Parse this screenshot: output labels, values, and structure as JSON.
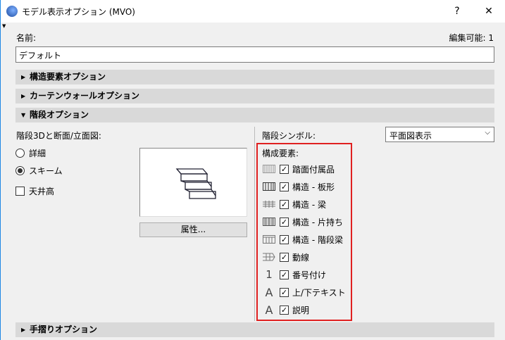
{
  "window": {
    "title": "モデル表示オプション (MVO)",
    "help": "?",
    "close": "✕"
  },
  "name_label": "名前:",
  "editable": "編集可能: 1",
  "name_value": "デフォルト",
  "sections": {
    "structure": "構造要素オプション",
    "curtain": "カーテンウォールオプション",
    "stair": "階段オプション",
    "railing": "手摺りオプション"
  },
  "stair": {
    "left_label": "階段3Dと断面/立面図:",
    "radio_detail": "詳細",
    "radio_scheme": "スキーム",
    "selected": "スキーム",
    "ceiling": "天井高",
    "ceiling_checked": false,
    "attr_button": "属性...",
    "symbol_label": "階段シンボル:",
    "symbol_value": "平面図表示",
    "components_label": "構成要素:",
    "components": [
      {
        "label": "踏面付属品",
        "icon": "tread-hatch-icon",
        "checked": true
      },
      {
        "label": "構造 - 板形",
        "icon": "structure-slab-icon",
        "checked": true
      },
      {
        "label": "構造 - 梁",
        "icon": "structure-beam-icon",
        "checked": true
      },
      {
        "label": "構造 - 片持ち",
        "icon": "structure-cantilever-icon",
        "checked": true
      },
      {
        "label": "構造 - 階段梁",
        "icon": "structure-stringer-icon",
        "checked": true
      },
      {
        "label": "動線",
        "icon": "walking-line-icon",
        "checked": true
      },
      {
        "label": "番号付け",
        "icon": "numbering-icon",
        "checked": true
      },
      {
        "label": "上/下テキスト",
        "icon": "text-icon",
        "checked": true
      },
      {
        "label": "説明",
        "icon": "text-icon",
        "checked": true
      }
    ]
  },
  "colors": {
    "highlight": "#e02020",
    "accent": "#1e88e5"
  }
}
